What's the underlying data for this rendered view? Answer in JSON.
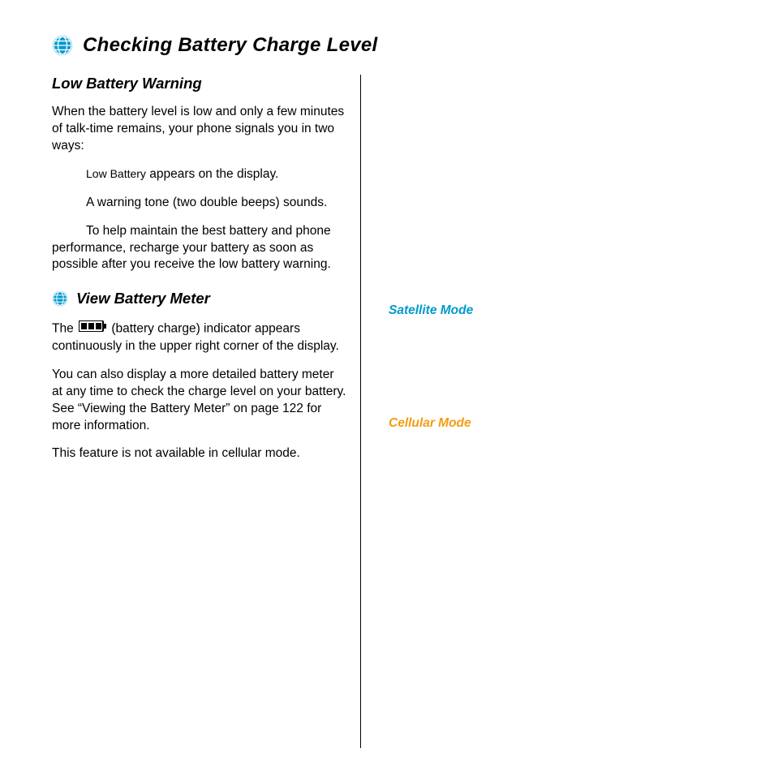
{
  "title": "Checking Battery Charge Level",
  "left": {
    "sub1_title": "Low Battery Warning",
    "p1": "When the battery level is low and only a few minutes of talk-time remains, your phone signals you in two ways:",
    "bullet1_pre": "Low Battery",
    "bullet1_post": " appears on the display.",
    "bullet2": "A warning tone (two double beeps) sounds.",
    "p2": "To help maintain the best battery and phone performance, recharge your battery as soon as possible after you receive the low battery warning.",
    "sub2_title": "View Battery Meter",
    "p3_pre": "The ",
    "p3_post": " (battery charge) indicator appears continuously in the upper right corner of the display.",
    "p4": "You can also display a more detailed battery meter at any time to check the charge level on your battery. See “Viewing the Battery Meter” on page 122 for more information.",
    "p5": "This feature is not available in cellular mode."
  },
  "right": {
    "satellite": "Satellite Mode",
    "cellular": "Cellular Mode"
  }
}
